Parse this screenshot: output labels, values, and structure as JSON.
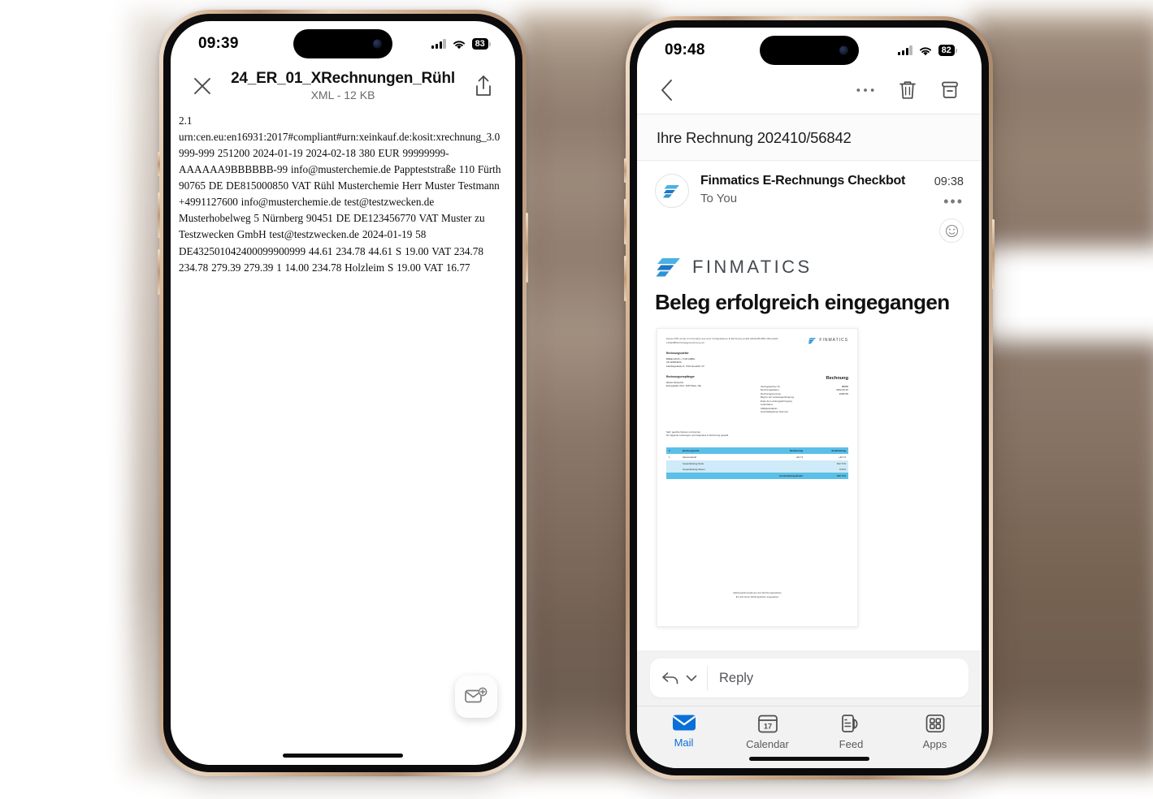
{
  "left_phone": {
    "status": {
      "time": "09:39",
      "battery": "83",
      "wifi_icon": "wifi-icon",
      "signal_icon": "cellular-icon"
    },
    "toolbar": {
      "close_icon": "close-icon",
      "share_icon": "share-icon",
      "title": "24_ER_01_XRechnungen_Rühl",
      "subtitle": "XML - 12 KB"
    },
    "document_text": "2.1 urn:cen.eu:en16931:2017#compliant#urn:xeinkauf.de:kosit:xrechnung_3.0 999-999 251200 2024-01-19 2024-02-18 380 EUR 99999999-AAAAAA9BBBBBB-99 info@musterchemie.de Pappteststraße 110 Fürth 90765 DE DE815000850 VAT Rühl Musterchemie Herr Muster Testmann +4991127600 info@musterchemie.de test@testzwecken.de Musterhobelweg 5 Nürnberg 90451 DE DE123456770 VAT Muster zu Testzwecken GmbH test@testzwecken.de 2024-01-19 58 DE432501042400099900999 44.61 234.78 44.61 S 19.00 VAT 234.78 234.78 279.39 279.39 1 14.00 234.78 Holzleim S 19.00 VAT 16.77",
    "fab": {
      "icon": "new-mail-icon",
      "label": "Neue Mail"
    }
  },
  "right_phone": {
    "status": {
      "time": "09:48",
      "battery": "82",
      "wifi_icon": "wifi-icon",
      "signal_icon": "cellular-icon"
    },
    "toolbar": {
      "back_icon": "back-chevron-icon",
      "more_icon": "more-options-icon",
      "delete_icon": "trash-icon",
      "archive_icon": "archive-icon"
    },
    "subject": "Ihre Rechnung 202410/56842",
    "message": {
      "sender": "Finmatics E-Rechnungs Checkbot",
      "recipient": "To You",
      "time": "09:38",
      "more_icon": "more-options-icon",
      "reaction_icon": "emoji-reaction-icon",
      "brand": "FINMATICS",
      "heading": "Beleg erfolgreich eingegangen"
    },
    "pdf_preview": {
      "note": "Dieses PDF wurde von Finmatics aus einer hochgeladenen E-Rechnung erstellt a4b0ce85-f881-42b2-a9e5-120eb985217e/beleg/xrechnung.xml",
      "brand": "FINMATICS",
      "issuer_label": "Rechnungssteller",
      "issuer_lines": [
        "BREE ZAUN + TOR GMBH",
        "ATU20954000",
        "Fabriksgelände 8, 7201 Neudörfl, AT"
      ],
      "recipient_label": "Rechnungsempfänger",
      "recipient_lines": [
        "Muster Erwerber",
        "Europaplatz 21/2, 1150 Wien, DE"
      ],
      "invoice_title": "Rechnung",
      "fields": [
        {
          "label": "Vertragspartner Nr",
          "value": "98099"
        },
        {
          "label": "Rechnungsdatum",
          "value": "2022-02-10"
        },
        {
          "label": "Rechnungsnummer",
          "value": "3236730"
        },
        {
          "label": "Beginn der Leistungserbringung",
          "value": ""
        },
        {
          "label": "Ende der Leistungserbringung",
          "value": ""
        },
        {
          "label": "Lieferdatum",
          "value": ""
        },
        {
          "label": "Fälligkeitsdatum",
          "value": ""
        },
        {
          "label": "Geschäftspartner Nummer",
          "value": ""
        }
      ],
      "salutation": [
        "Sehr geehrte Damen und Herren,",
        "für folgende Leistungen und folgendes in Rechnung gestellt"
      ],
      "table_headers": [
        "#",
        "Buchungszeile",
        "Nettobetrag",
        "Bruttobetrag"
      ],
      "table_rows": [
        {
          "num": "1",
          "desc": "Zaunmaterial",
          "net": "+40.74",
          "gross": "+40.74"
        }
      ],
      "totals": [
        {
          "label": "Gesamtbetrag Netto",
          "value": "402.74 €"
        },
        {
          "label": "Gesamtbetrag Steuer",
          "value": "0.00 €"
        },
        {
          "label": "Gesamtbetrag Brutto",
          "value": "402.74 €"
        }
      ],
      "footer": [
        "Zahlungsinformationen des Rechnungsstellers",
        "Es sind keine Zahlungsdaten angegeben"
      ]
    },
    "reply": {
      "reply_icon": "reply-arrow-icon",
      "chevron_icon": "chevron-down-icon",
      "placeholder": "Reply"
    },
    "tabs": [
      {
        "label": "Mail",
        "icon": "mail-icon",
        "active": true
      },
      {
        "label": "Calendar",
        "icon": "calendar-icon",
        "active": false
      },
      {
        "label": "Feed",
        "icon": "feed-icon",
        "active": false
      },
      {
        "label": "Apps",
        "icon": "apps-grid-icon",
        "active": false
      }
    ],
    "calendar_day": "17"
  },
  "colors": {
    "accent_blue": "#0a6fd8",
    "brand_blue_light": "#3fa9e0",
    "brand_blue_dark": "#1565b8",
    "pdf_table_header": "#5bc0e8",
    "backdrop_brown": "#8b786a"
  }
}
